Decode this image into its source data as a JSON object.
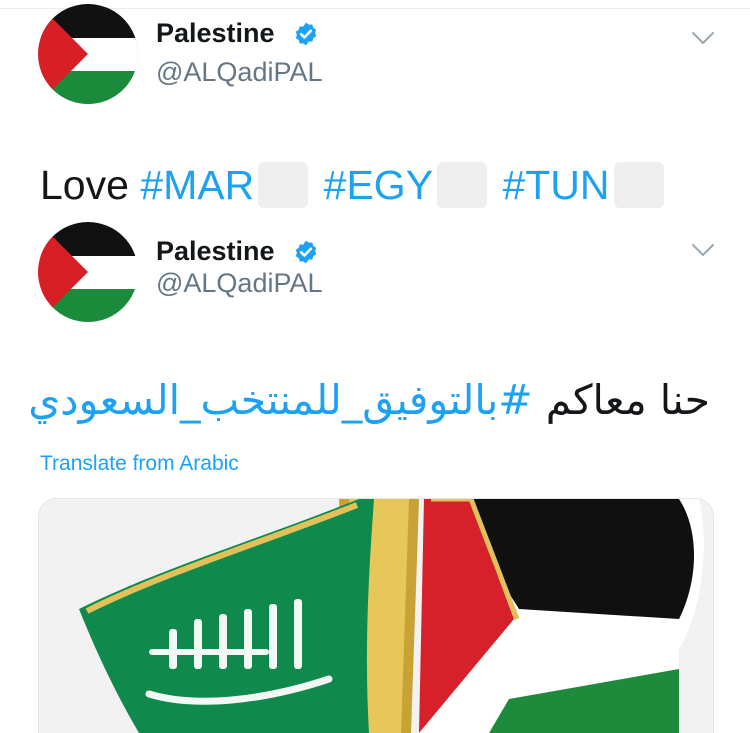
{
  "tweets": [
    {
      "author_name": "Palestine",
      "author_handle": "@ALQadiPAL",
      "verified": true,
      "text_prefix": "Love",
      "hashtags": [
        "#MAR",
        "#EGY",
        "#TUN"
      ]
    },
    {
      "author_name": "Palestine",
      "author_handle": "@ALQadiPAL",
      "verified": true,
      "text_plain": "حنا معاكم",
      "hashtag": "#بالتوفيق_للمنتخب_السعودي",
      "translate_label": "Translate from Arabic",
      "media_description_icon": "saudi-palestine-flags-pin"
    }
  ],
  "icons": {
    "verified": "verified-badge-icon",
    "caret": "chevron-down-icon",
    "emoji_placeholder": "emoji-placeholder"
  },
  "colors": {
    "link": "#1da1f2",
    "handle": "#657786",
    "text": "#14171a",
    "verified": "#1da1f2"
  }
}
